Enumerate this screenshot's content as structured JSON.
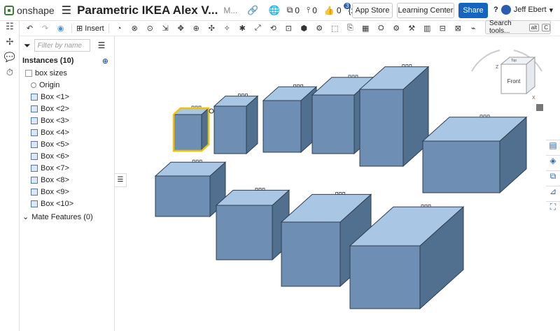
{
  "app": {
    "brand": "onshape",
    "title": "Parametric IKEA Alex V...",
    "version_tag": "M..."
  },
  "topbar": {
    "versions_count": "0",
    "branches_count": "0",
    "likes_count": "0",
    "variables_label": "{x}",
    "notifications_badge": "3",
    "app_store_label": "App Store",
    "learning_center_label": "Learning Center",
    "share_label": "Share",
    "help_label": "?",
    "user_name": "Jeff Ebert"
  },
  "toolbar": {
    "insert_label": "Insert",
    "search_tools_label": "Search tools...",
    "search_shortcut_alt": "alt",
    "search_shortcut_key": "C"
  },
  "panel": {
    "filter_placeholder": "Filter by name",
    "instances_header": "Instances (10)",
    "tree": [
      {
        "label": "box sizes",
        "kind": "folder"
      },
      {
        "label": "Origin",
        "kind": "origin"
      },
      {
        "label": "Box <1>",
        "kind": "part"
      },
      {
        "label": "Box <2>",
        "kind": "part"
      },
      {
        "label": "Box <3>",
        "kind": "part"
      },
      {
        "label": "Box <4>",
        "kind": "part"
      },
      {
        "label": "Box <5>",
        "kind": "part"
      },
      {
        "label": "Box <6>",
        "kind": "part"
      },
      {
        "label": "Box <7>",
        "kind": "part"
      },
      {
        "label": "Box <8>",
        "kind": "part"
      },
      {
        "label": "Box <9>",
        "kind": "part"
      },
      {
        "label": "Box <10>",
        "kind": "part"
      }
    ],
    "mate_features_label": "Mate Features (0)"
  },
  "viewcube": {
    "face_front": "Front",
    "face_top": "Top",
    "axis_x": "X",
    "axis_z": "Z"
  },
  "colors": {
    "box_top": "#a9c6e4",
    "box_side": "#51708f",
    "box_front": "#6e8fb3",
    "selection": "#f2c200",
    "accent": "#1565c0"
  }
}
